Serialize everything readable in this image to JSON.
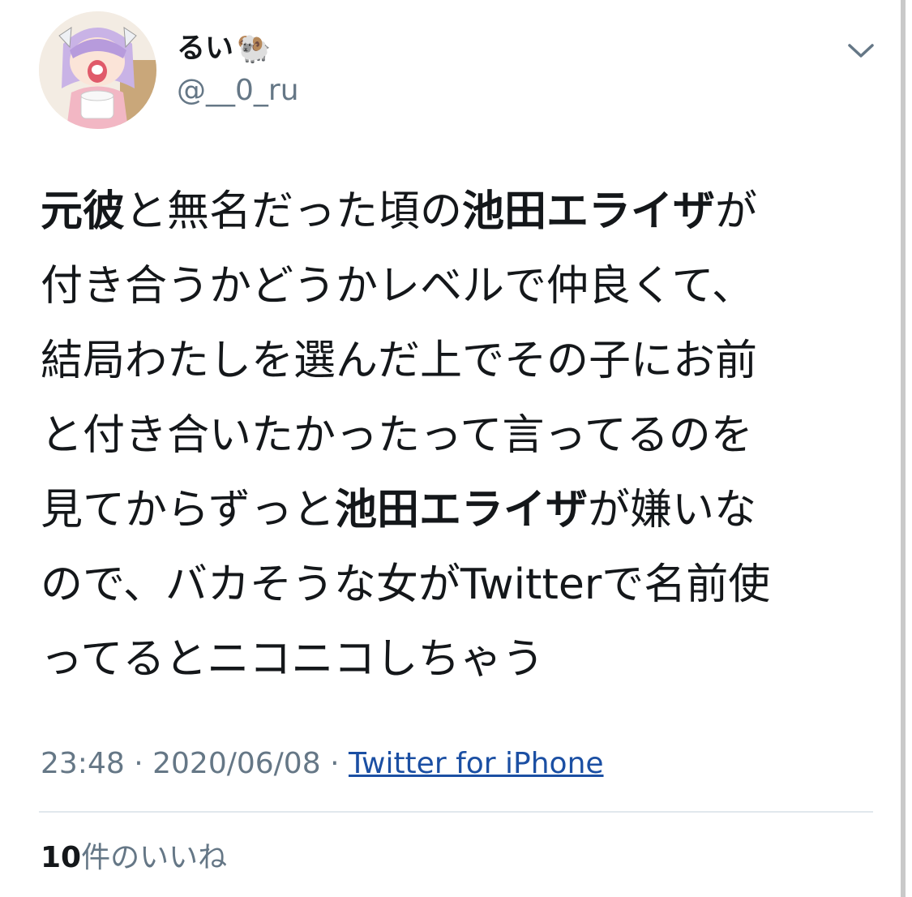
{
  "profile": {
    "display_name": "るい",
    "name_emoji": "🐏",
    "handle": "@__0_ru",
    "avatar_icon": "anime-girl-avatar"
  },
  "menu": {
    "icon": "chevron-down-icon"
  },
  "tweet": {
    "lines": [
      [
        {
          "t": "元彼",
          "b": true
        },
        {
          "t": "と無名だった頃の",
          "b": false
        },
        {
          "t": "池田エライザ",
          "b": true
        },
        {
          "t": "が",
          "b": false
        }
      ],
      [
        {
          "t": "付き合うかどうかレベルで仲良くて、",
          "b": false
        }
      ],
      [
        {
          "t": "結局わたしを選んだ上でその子にお前",
          "b": false
        }
      ],
      [
        {
          "t": "と付き合いたかったって言ってるのを",
          "b": false
        }
      ],
      [
        {
          "t": "見てからずっと",
          "b": false
        },
        {
          "t": "池田エライザ",
          "b": true
        },
        {
          "t": "が嫌いな",
          "b": false
        }
      ],
      [
        {
          "t": "ので、バカそうな女がTwitterで名前使",
          "b": false
        }
      ],
      [
        {
          "t": "ってるとニコニコしちゃう",
          "b": false
        }
      ]
    ]
  },
  "meta": {
    "time": "23:48",
    "separator": "·",
    "date": "2020/06/08",
    "source": "Twitter for iPhone"
  },
  "stats": {
    "likes_count": "10",
    "likes_label": "件のいいね"
  },
  "colors": {
    "text": "#14171a",
    "secondary": "#657786",
    "link": "#1b4fa3",
    "divider": "#e1e8ed"
  }
}
